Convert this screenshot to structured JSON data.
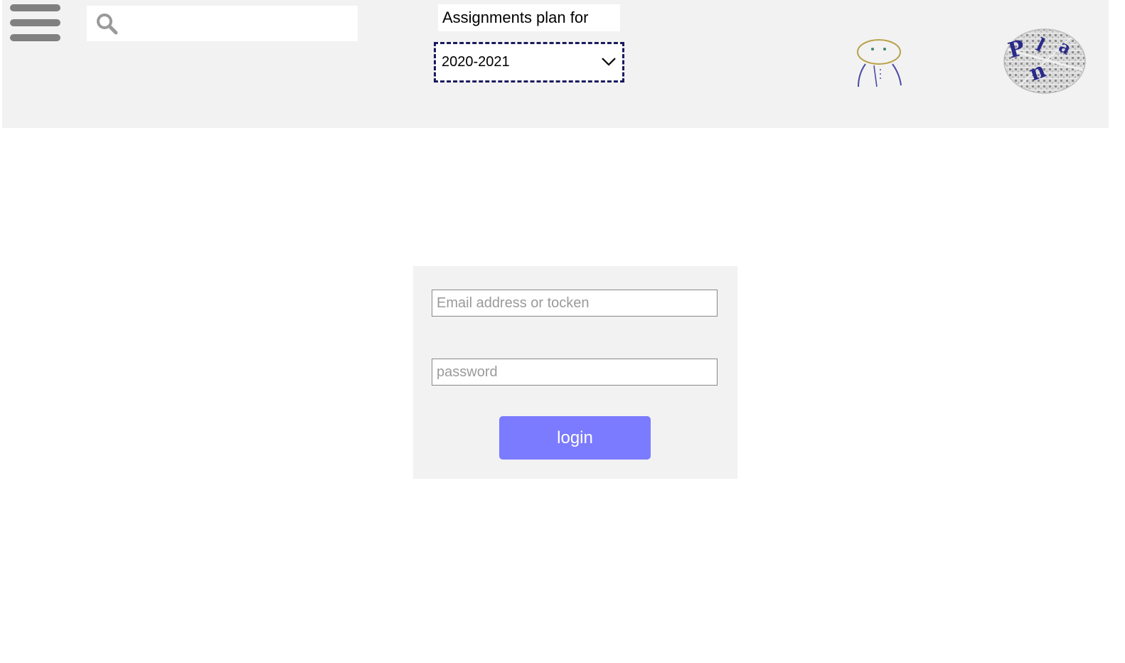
{
  "header": {
    "menu_icon": "hamburger-menu-icon",
    "search": {
      "icon": "search-icon",
      "value": "",
      "placeholder": ""
    },
    "plan_label": "Assignments plan for",
    "year_select": {
      "selected": "2020-2021",
      "icon": "chevron-down-icon"
    },
    "user_icon": "user-avatar-icon",
    "logo_icon": "plan-logo-icon",
    "logo_letters": [
      "P",
      "l",
      "a",
      "n"
    ]
  },
  "login": {
    "email_placeholder": "Email address or tocken",
    "email_value": "",
    "password_placeholder": "password",
    "password_value": "",
    "button_label": "login"
  },
  "colors": {
    "header_bg": "#f2f2f2",
    "panel_bg": "#f2f2f2",
    "button_bg": "#7b7bff",
    "button_text": "#ffffff",
    "select_border": "#1a1a5e",
    "icon_gray": "#808080"
  }
}
